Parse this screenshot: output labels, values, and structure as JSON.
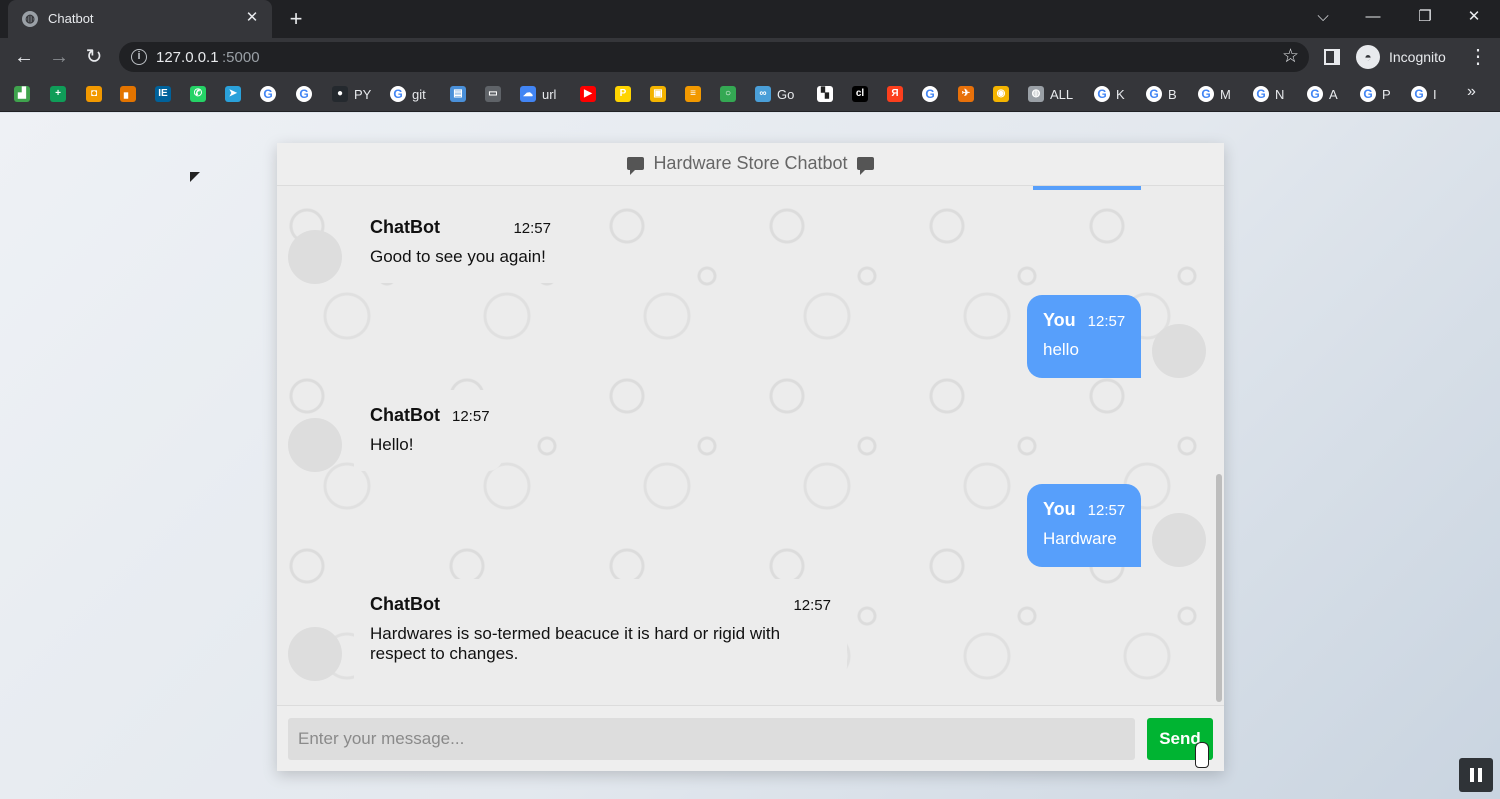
{
  "browser": {
    "tab_title": "Chatbot",
    "tab_close": "✕",
    "new_tab": "+",
    "window_controls": {
      "tab_search": "⌵",
      "minimize": "—",
      "restore": "❐",
      "close": "✕"
    },
    "nav": {
      "back": "←",
      "forward": "→",
      "reload": "↻"
    },
    "url_host": "127.0.0.1",
    "url_port": ":5000",
    "profile_label": "Incognito",
    "bookmarks": [
      {
        "label": "",
        "icon": "bookmark-green-icon",
        "color": "#3fa34d",
        "glyph": "▟"
      },
      {
        "label": "",
        "icon": "sheets-icon",
        "color": "#0f9d58",
        "glyph": "+"
      },
      {
        "label": "",
        "icon": "orange-app-icon",
        "color": "#f29900",
        "glyph": "◘"
      },
      {
        "label": "",
        "icon": "analytics-icon",
        "color": "#e37400",
        "glyph": "▖"
      },
      {
        "label": "",
        "icon": "ieee-icon",
        "color": "#00629b",
        "glyph": "IE"
      },
      {
        "label": "",
        "icon": "whatsapp-icon",
        "color": "#25d366",
        "glyph": "✆"
      },
      {
        "label": "",
        "icon": "telegram-icon",
        "color": "#2aa1da",
        "glyph": "➤"
      },
      {
        "label": "",
        "icon": "google-icon",
        "color": "#ffffff",
        "glyph": "G"
      },
      {
        "label": "",
        "icon": "google-icon",
        "color": "#ffffff",
        "glyph": "G"
      },
      {
        "label": "PY",
        "icon": "github-icon",
        "color": "#24292e",
        "glyph": "●"
      },
      {
        "label": "git",
        "icon": "google-icon",
        "color": "#ffffff",
        "glyph": "G"
      },
      {
        "label": "",
        "icon": "calendar-icon",
        "color": "#4a90d9",
        "glyph": "▤"
      },
      {
        "label": "",
        "icon": "store-icon",
        "color": "#5f6368",
        "glyph": "▭"
      },
      {
        "label": "url",
        "icon": "cloud-icon",
        "color": "#4285f4",
        "glyph": "☁"
      },
      {
        "label": "",
        "icon": "youtube-icon",
        "color": "#ff0000",
        "glyph": "▶"
      },
      {
        "label": "",
        "icon": "p-icon",
        "color": "#ffd400",
        "glyph": "P"
      },
      {
        "label": "",
        "icon": "film-icon",
        "color": "#f4b400",
        "glyph": "▣"
      },
      {
        "label": "",
        "icon": "cart-icon",
        "color": "#f29900",
        "glyph": "≡"
      },
      {
        "label": "",
        "icon": "circle-icon",
        "color": "#34a853",
        "glyph": "○"
      },
      {
        "label": "Go",
        "icon": "go-icon",
        "color": "#4a9fd8",
        "glyph": "∞"
      },
      {
        "label": "",
        "icon": "doc-icon",
        "color": "#ffffff",
        "glyph": "▚"
      },
      {
        "label": "",
        "icon": "cl-icon",
        "color": "#000000",
        "glyph": "cl"
      },
      {
        "label": "",
        "icon": "yandex-icon",
        "color": "#fc3f1d",
        "glyph": "Я"
      },
      {
        "label": "",
        "icon": "google-icon",
        "color": "#ffffff",
        "glyph": "G"
      },
      {
        "label": "",
        "icon": "bird-icon",
        "color": "#e8710a",
        "glyph": "✈"
      },
      {
        "label": "",
        "icon": "eye-icon",
        "color": "#f4b400",
        "glyph": "◉"
      },
      {
        "label": "ALL",
        "icon": "globe-icon",
        "color": "#9aa0a6",
        "glyph": "◍"
      },
      {
        "label": "K",
        "icon": "google-icon",
        "color": "#ffffff",
        "glyph": "G"
      },
      {
        "label": "B",
        "icon": "google-icon",
        "color": "#ffffff",
        "glyph": "G"
      },
      {
        "label": "M",
        "icon": "google-icon",
        "color": "#ffffff",
        "glyph": "G"
      },
      {
        "label": "N",
        "icon": "google-icon",
        "color": "#ffffff",
        "glyph": "G"
      },
      {
        "label": "A",
        "icon": "google-icon",
        "color": "#ffffff",
        "glyph": "G"
      },
      {
        "label": "P",
        "icon": "google-icon",
        "color": "#ffffff",
        "glyph": "G"
      },
      {
        "label": "I",
        "icon": "google-icon",
        "color": "#ffffff",
        "glyph": "G"
      }
    ],
    "bookmarks_more": "»"
  },
  "chat": {
    "header_title": "Hardware Store Chatbot",
    "messages": [
      {
        "side": "left",
        "name": "ChatBot",
        "time": "12:57",
        "text": "Good to see you again!"
      },
      {
        "side": "right",
        "name": "You",
        "time": "12:57",
        "text": "hello"
      },
      {
        "side": "left",
        "name": "ChatBot",
        "time": "12:57",
        "text": "Hello!"
      },
      {
        "side": "right",
        "name": "You",
        "time": "12:57",
        "text": "Hardware"
      },
      {
        "side": "left",
        "name": "ChatBot",
        "time": "12:57",
        "text": "Hardwares is so-termed beacuce it is hard or rigid with respect to changes."
      }
    ],
    "input_placeholder": "Enter your message...",
    "send_label": "Send"
  },
  "colors": {
    "user_bubble": "#579ffb",
    "bot_bubble": "#ececec",
    "send_button": "#00b432"
  }
}
